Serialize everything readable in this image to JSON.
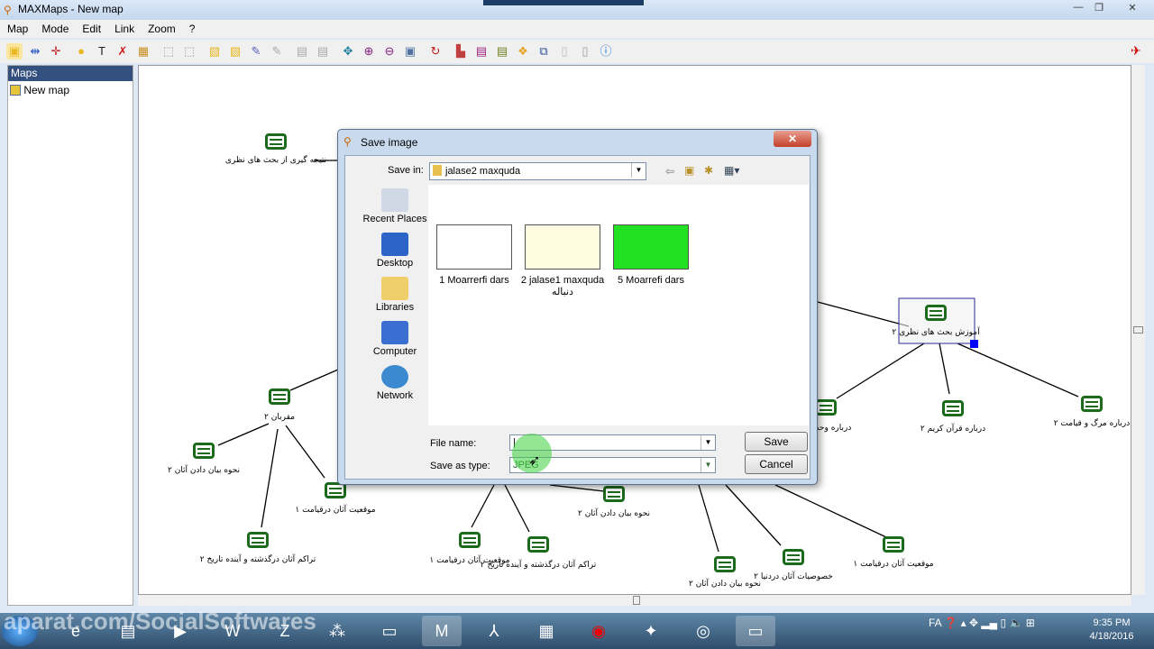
{
  "window": {
    "title": "MAXMaps - New map",
    "minimize": "—",
    "maximize": "❐",
    "close": "✕"
  },
  "menu": [
    "Map",
    "Mode",
    "Edit",
    "Link",
    "Zoom",
    "?"
  ],
  "toolbar_icons": [
    "select-mode-icon",
    "link-mode-icon",
    "move-mode-icon",
    "add-node-icon",
    "add-text-icon",
    "delete-icon",
    "properties-icon",
    "select-all-icon",
    "deselect-icon",
    "bring-front-icon",
    "send-back-icon",
    "format-icon",
    "format-disabled-icon",
    "copy-icon",
    "paste-icon",
    "fit-icon",
    "zoom-in-icon",
    "zoom-out-icon",
    "zoom-frame-icon",
    "refresh-icon",
    "print-icon",
    "export-icon",
    "notes-icon",
    "arrange-icon",
    "duplicate-icon",
    "blank-icon",
    "clear-icon",
    "info-icon"
  ],
  "sidebar": {
    "header": "Maps",
    "items": [
      {
        "label": "New map"
      }
    ]
  },
  "map": {
    "nodes": [
      {
        "label": "نتیجه گیری از بحث های نظری"
      },
      {
        "label": "مقربان ۲"
      },
      {
        "label": "نحوه بیان دادن آثان ۲"
      },
      {
        "label": "موقعیت آثان درقیامت ۱"
      },
      {
        "label": "تراکم آثان درگذشته و آینده تاریخ ۲"
      },
      {
        "label": "موقعیت آثان درقیامت ۱"
      },
      {
        "label": "تراکم آثان درگذشته و آینده تاریخ ۲"
      },
      {
        "label": "نحوه بیان دادن آثان ۲"
      },
      {
        "label": "نحوه بیان دادن آثان ۲"
      },
      {
        "label": "خصوصیات آثان دردنیا ۲"
      },
      {
        "label": "موقعیت آثان درقیامت ۱"
      },
      {
        "label": "آموزش بحث های نظری ۲"
      },
      {
        "label": "درباره وحدانیت"
      },
      {
        "label": "درباره قرآن کریم ۲"
      },
      {
        "label": "درباره مرگ و قیامت ۲"
      }
    ]
  },
  "dialog": {
    "title": "Save image",
    "close": "✕",
    "save_in_label": "Save in:",
    "save_in_value": "jalase2 maxquda",
    "places": [
      "Recent Places",
      "Desktop",
      "Libraries",
      "Computer",
      "Network"
    ],
    "files": [
      {
        "name": "1 Moarrerfi dars"
      },
      {
        "name": "2 jalase1 maxquda",
        "name2": "دنباله"
      },
      {
        "name": "5 Moarrefi dars"
      }
    ],
    "file_name_label": "File name:",
    "file_name_value": "|",
    "save_type_label": "Save as type:",
    "save_type_value": "JPEG",
    "save_button": "Save",
    "cancel_button": "Cancel"
  },
  "taskbar": {
    "language": "FA",
    "time": "9:35 PM",
    "date": "4/18/2016"
  },
  "watermark": "aparat.com/SocialSoftwares",
  "colors": {
    "node": "#1c6a1c",
    "sidebar_header": "#34507e",
    "selection": "#0000ff"
  }
}
